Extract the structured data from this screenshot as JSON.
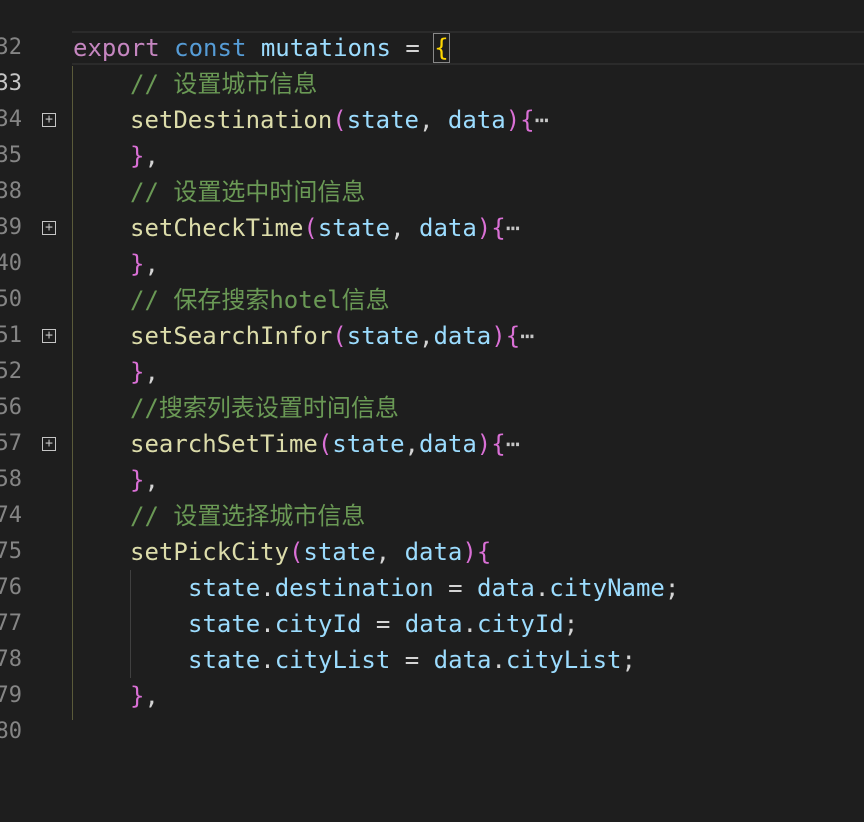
{
  "gutter": {
    "line_numbers": [
      "32",
      "33",
      "34",
      "35",
      "38",
      "39",
      "40",
      "50",
      "51",
      "52",
      "56",
      "57",
      "58",
      "74",
      "75",
      "76",
      "77",
      "78",
      "79",
      "80"
    ]
  },
  "code": {
    "l33": {
      "kw": "export",
      "kwb": "const",
      "name": "mutations",
      "eq": "=",
      "brace": "{"
    },
    "l34": {
      "comment": "// 设置城市信息"
    },
    "l35": {
      "fn": "setDestination",
      "lp": "(",
      "a1": "state",
      "sep": ", ",
      "a2": "data",
      "rp": ")",
      "lb": "{",
      "ellipsis": "⋯"
    },
    "l38": {
      "rb": "}",
      "comma": ","
    },
    "l39": {
      "comment": "// 设置选中时间信息"
    },
    "l40": {
      "fn": "setCheckTime",
      "lp": "(",
      "a1": "state",
      "sep": ", ",
      "a2": "data",
      "rp": ")",
      "lb": "{",
      "ellipsis": "⋯"
    },
    "l50": {
      "rb": "}",
      "comma": ","
    },
    "l51": {
      "comment": "// 保存搜索hotel信息"
    },
    "l52": {
      "fn": "setSearchInfor",
      "lp": "(",
      "a1": "state",
      "sep": ",",
      "a2": "data",
      "rp": ")",
      "lb": "{",
      "ellipsis": "⋯"
    },
    "l56": {
      "rb": "}",
      "comma": ","
    },
    "l57": {
      "comment": "//搜索列表设置时间信息"
    },
    "l58": {
      "fn": "searchSetTime",
      "lp": "(",
      "a1": "state",
      "sep": ",",
      "a2": "data",
      "rp": ")",
      "lb": "{",
      "ellipsis": "⋯"
    },
    "l74": {
      "rb": "}",
      "comma": ","
    },
    "l75": {
      "comment": "// 设置选择城市信息"
    },
    "l76": {
      "fn": "setPickCity",
      "lp": "(",
      "a1": "state",
      "sep": ", ",
      "a2": "data",
      "rp": ")",
      "lb": "{"
    },
    "l77": {
      "obj": "state",
      "dot": ".",
      "prop": "destination",
      "eq": " = ",
      "obj2": "data",
      "dot2": ".",
      "prop2": "cityName",
      "semi": ";"
    },
    "l78": {
      "obj": "state",
      "dot": ".",
      "prop": "cityId",
      "eq": " = ",
      "obj2": "data",
      "dot2": ".",
      "prop2": "cityId",
      "semi": ";"
    },
    "l79": {
      "obj": "state",
      "dot": ".",
      "prop": "cityList",
      "eq": " = ",
      "obj2": "data",
      "dot2": ".",
      "prop2": "cityList",
      "semi": ";"
    },
    "l80": {
      "rb": "}",
      "comma": ","
    }
  },
  "icons": {
    "fold": "expand-plus-icon"
  },
  "colors": {
    "background": "#1e1e1e",
    "keyword": "#c586c0",
    "storage": "#569cd6",
    "variable": "#9cdcfe",
    "function": "#dcdcaa",
    "comment": "#6a9955",
    "property": "#4fc1ff",
    "bracket1": "#ffd700",
    "bracket2": "#da70d6",
    "bracket3": "#179fff"
  }
}
